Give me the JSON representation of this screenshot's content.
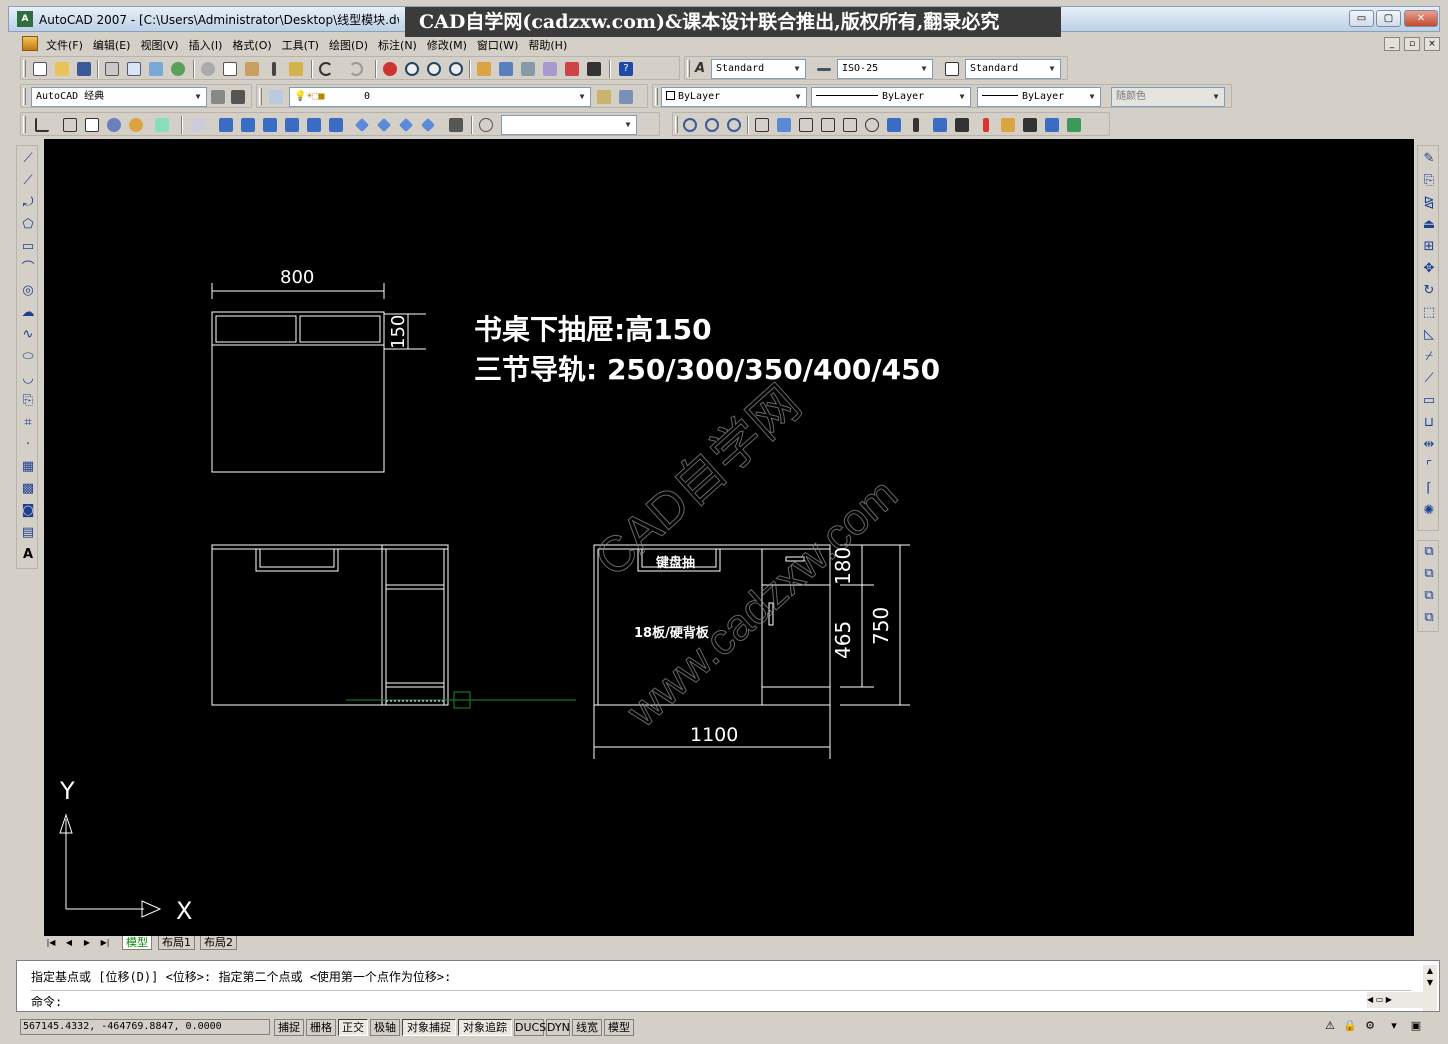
{
  "window": {
    "title": "AutoCAD 2007 - [C:\\Users\\Administrator\\Desktop\\线型模块.dw",
    "banner": "CAD自学网(cadzxw.com)&课本设计联合推出,版权所有,翻录必究",
    "min_label": "▭",
    "max_label": "▢",
    "close_label": "✕"
  },
  "menu": {
    "items": [
      "文件(F)",
      "编辑(E)",
      "视图(V)",
      "插入(I)",
      "格式(O)",
      "工具(T)",
      "绘图(D)",
      "标注(N)",
      "修改(M)",
      "窗口(W)",
      "帮助(H)"
    ]
  },
  "styles": {
    "text_style": "Standard",
    "dim_style": "ISO-25",
    "table_style": "Standard"
  },
  "workspace": {
    "name": "AutoCAD 经典"
  },
  "layer": {
    "current": "0"
  },
  "properties": {
    "color": "ByLayer",
    "linetype": "ByLayer",
    "lineweight": "ByLayer",
    "plot_style": "随颜色"
  },
  "drawing": {
    "note_line1": "书桌下抽屉:高150",
    "note_line2": "三节导轨: 250/300/350/400/450",
    "dim_top_width": "800",
    "dim_drawer_height": "150",
    "dim_front_width": "1100",
    "dim_drawer_180": "180",
    "dim_465": "465",
    "dim_750": "750",
    "label_keyboard": "键盘抽",
    "label_board": "18板/硬背板",
    "watermark1": "CAD自学网",
    "watermark2": "www.cadzxw.com",
    "ucs_x": "X",
    "ucs_y": "Y"
  },
  "tabs": {
    "model": "模型",
    "layout1": "布局1",
    "layout2": "布局2"
  },
  "command": {
    "history": "指定基点或 [位移(D)] <位移>:  指定第二个点或 <使用第一个点作为位移>:",
    "prompt": "命令:"
  },
  "status": {
    "coords": "567145.4332, -464769.8847, 0.0000",
    "snap": "捕捉",
    "grid": "栅格",
    "ortho": "正交",
    "polar": "极轴",
    "osnap": "对象捕捉",
    "otrack": "对象追踪",
    "ducs": "DUCS",
    "dyn": "DYN",
    "lwt": "线宽",
    "model": "模型"
  },
  "colors": {
    "canvas_bg": "#000000",
    "drawing_line": "#ffffff",
    "track_line": "#1a8a2a"
  }
}
